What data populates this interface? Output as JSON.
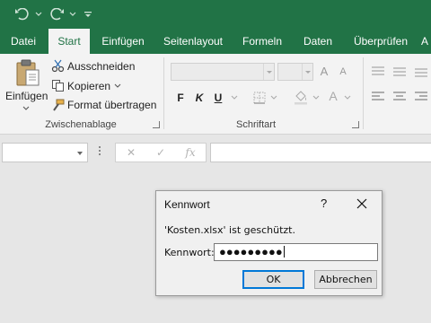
{
  "tabs": [
    {
      "label": "Datei"
    },
    {
      "label": "Start"
    },
    {
      "label": "Einfügen"
    },
    {
      "label": "Seitenlayout"
    },
    {
      "label": "Formeln"
    },
    {
      "label": "Daten"
    },
    {
      "label": "Überprüfen"
    },
    {
      "label": "A"
    }
  ],
  "clipboard": {
    "paste_label": "Einfügen",
    "cut_label": "Ausschneiden",
    "copy_label": "Kopieren",
    "format_painter_label": "Format übertragen",
    "group_label": "Zwischenablage"
  },
  "font": {
    "bold_label": "F",
    "italic_label": "K",
    "underline_label": "U",
    "grow_label": "A",
    "shrink_label": "A",
    "font_color_label": "A",
    "group_label": "Schriftart"
  },
  "formula_bar": {
    "cancel_symbol": "✕",
    "enter_symbol": "✓",
    "function_symbol": "fx"
  },
  "dialog": {
    "title": "Kennwort",
    "help_symbol": "?",
    "message": "'Kosten.xlsx' ist geschützt.",
    "password_label": "Kennwort:",
    "password_value": "●●●●●●●●●",
    "ok_label": "OK",
    "cancel_label": "Abbrechen"
  },
  "colors": {
    "accent": "#217346",
    "ribbon_bg": "#f3f3f3",
    "dialog_focus": "#0078d7"
  }
}
